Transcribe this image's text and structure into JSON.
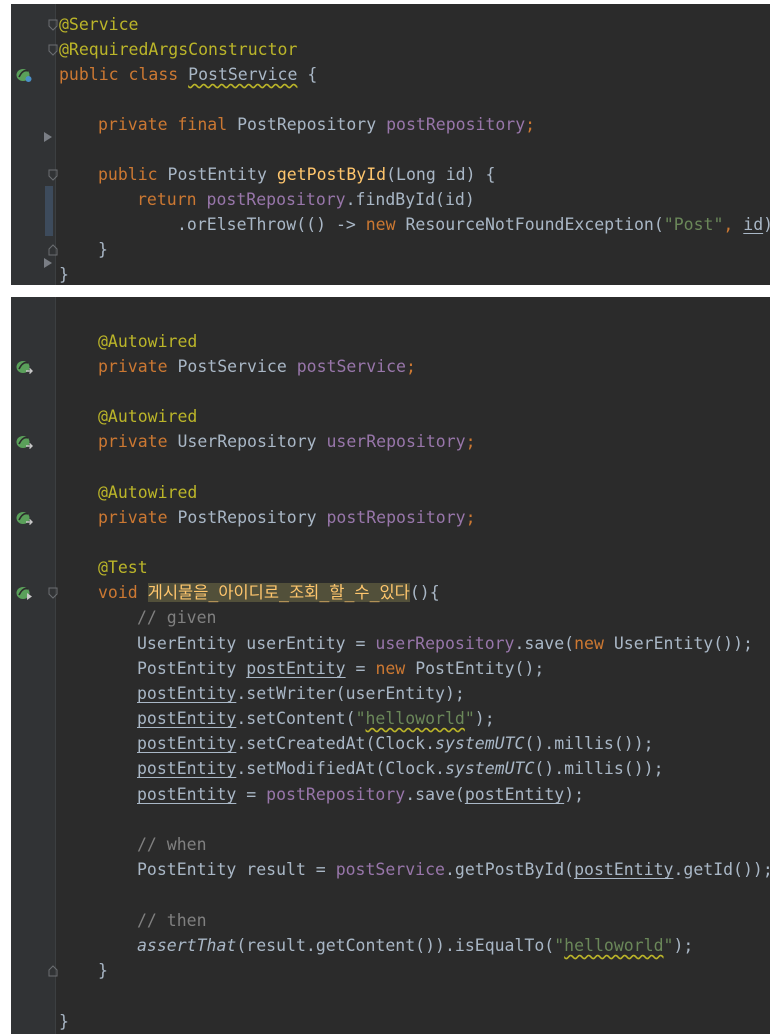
{
  "top_panel": {
    "line1": "@Service",
    "line2": "@RequiredArgsConstructor",
    "l3_kw": "public class ",
    "l3_class": "PostService",
    "l3_brace": " {",
    "l5_kw": "private final ",
    "l5_type": "PostRepository ",
    "l5_field": "postRepository",
    "l5_semi": ";",
    "l7_kw": "public ",
    "l7_type": "PostEntity ",
    "l7_method": "getPostById",
    "l7_params": "(Long id) {",
    "l8_kw": "return ",
    "l8_field": "postRepository",
    "l8_rest": ".findById(id)",
    "l9_pre": ".orElseThrow(() -> ",
    "l9_new": "new ",
    "l9_cls": "ResourceNotFoundException(",
    "l9_str": "\"Post\"",
    "l9_comma": ", ",
    "l9_id": "id",
    "l9_end": "));",
    "l10": "}",
    "l11": "}"
  },
  "bottom_panel": {
    "autowired": "@Autowired",
    "f1_kw": "private ",
    "f1_type": "PostService ",
    "f1_name": "postService",
    "f2_type": "UserRepository ",
    "f2_name": "userRepository",
    "f3_type": "PostRepository ",
    "f3_name": "postRepository",
    "semi": ";",
    "test_ann": "@Test",
    "void_kw": "void ",
    "test_name": "게시물을_아이디로_조회_할_수_있다",
    "test_end": "(){",
    "c_given": "// given",
    "g1_a": "UserEntity userEntity = ",
    "g1_b": "userRepository",
    "g1_c": ".save(",
    "g1_d": "new ",
    "g1_e": "UserEntity());",
    "g2_a": "PostEntity ",
    "g2_b": "postEntity",
    "g2_c": " = ",
    "g2_d": "new ",
    "g2_e": "PostEntity();",
    "var": "postEntity",
    "g3_rest": ".setWriter(userEntity);",
    "g4_a": ".setContent(",
    "g4_q1": "\"",
    "g4_s": "helloworld",
    "g4_q2": "\"",
    "g4_end": ");",
    "g5_a": ".setCreatedAt(Clock.",
    "sys": "systemUTC",
    "mil": "().millis());",
    "g6_a": ".setModifiedAt(Clock.",
    "g7_a": " = ",
    "g7_b": "postRepository",
    "g7_c": ".save(",
    "g7_d": ");",
    "c_when": "// when",
    "w1_a": "PostEntity result = ",
    "w1_b": "postService",
    "w1_c": ".getPostById(",
    "w1_d": ".getId());",
    "c_then": "// then",
    "t1_a": "assertThat",
    "t1_b": "(result.getContent()).isEqualTo(",
    "t1_end": ");",
    "close1": "}",
    "close2": "}"
  }
}
